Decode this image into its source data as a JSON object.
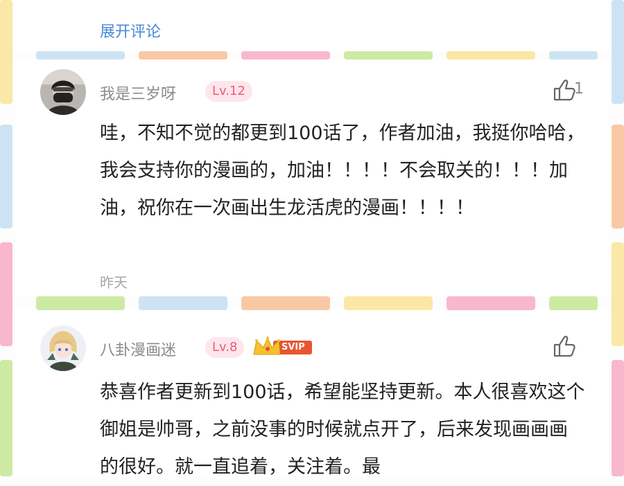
{
  "expand_comments": "展开评论",
  "comments": [
    {
      "username": "我是三岁呀",
      "level": "Lv.12",
      "like_count": "1",
      "body": "哇，不知不觉的都更到100话了，作者加油，我挺你哈哈，我会支持你的漫画的，加油！！！！不会取关的！！！加油，祝你在一次画出生龙活虎的漫画！！！！",
      "timestamp": "昨天",
      "avatar_icon": "masked-person-avatar"
    },
    {
      "username": "八卦漫画迷",
      "level": "Lv.8",
      "vip_badge": "SVIP",
      "body": "恭喜作者更新到100话，希望能坚持更新。本人很喜欢这个御姐是帅哥，之前没事的时候就点开了，后来发现画画画的很好。就一直追着，关注着。最",
      "avatar_icon": "anime-girl-avatar"
    }
  ],
  "colors": {
    "link": "#4a8ad8",
    "level_text": "#f05a7a",
    "level_bg": "#fde6ec",
    "username": "#8a8a8a",
    "body_text": "#222222",
    "timestamp": "#a6a6a6"
  },
  "frame_palette": [
    "#a8d4f0",
    "#f9c9a6",
    "#f9b7cf",
    "#cdeaa3",
    "#fbe7a6"
  ]
}
